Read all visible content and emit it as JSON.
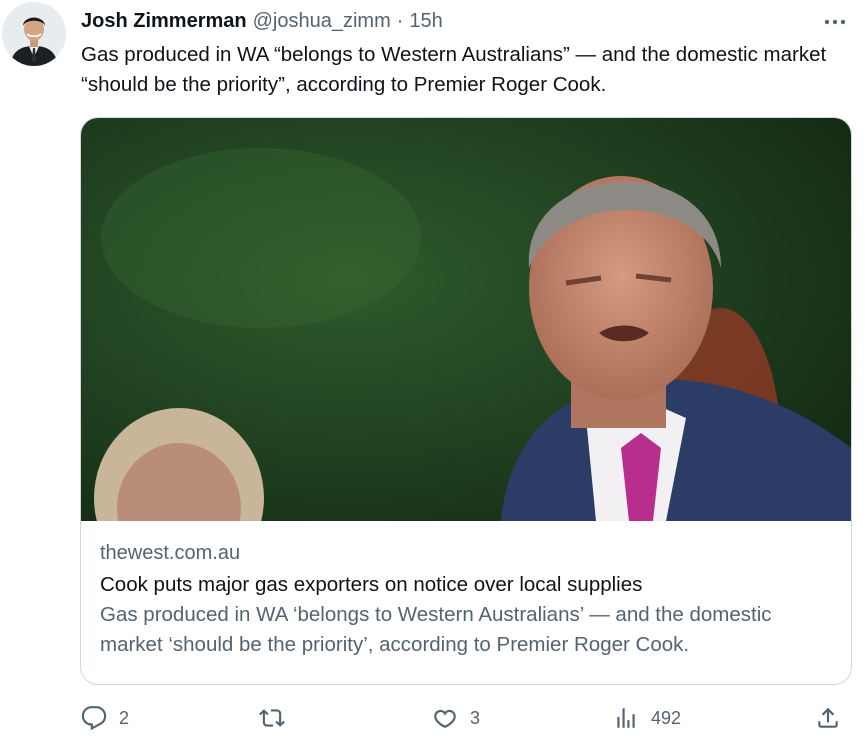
{
  "author": {
    "name": "Josh Zimmerman",
    "handle": "@joshua_zimm",
    "separator": "·",
    "timestamp": "15h"
  },
  "tweet": {
    "text": "Gas produced in WA “belongs to Western Australians” — and the domestic market “should be the priority”, according to Premier Roger Cook."
  },
  "card": {
    "domain": "thewest.com.au",
    "title": "Cook puts major gas exporters on notice over local supplies",
    "description": "Gas produced in WA ‘belongs to Western Australians’ — and the domestic market ‘should be the priority’, according to Premier Roger Cook."
  },
  "actions": {
    "replies": "2",
    "retweets": "",
    "likes": "3",
    "views": "492"
  },
  "icons": {
    "more": "more-dots-icon",
    "reply": "reply-icon",
    "retweet": "retweet-icon",
    "like": "heart-icon",
    "views": "analytics-icon",
    "share": "share-icon"
  },
  "colors": {
    "text_primary": "#0f1419",
    "text_secondary": "#536471",
    "border": "#cfd9de"
  }
}
